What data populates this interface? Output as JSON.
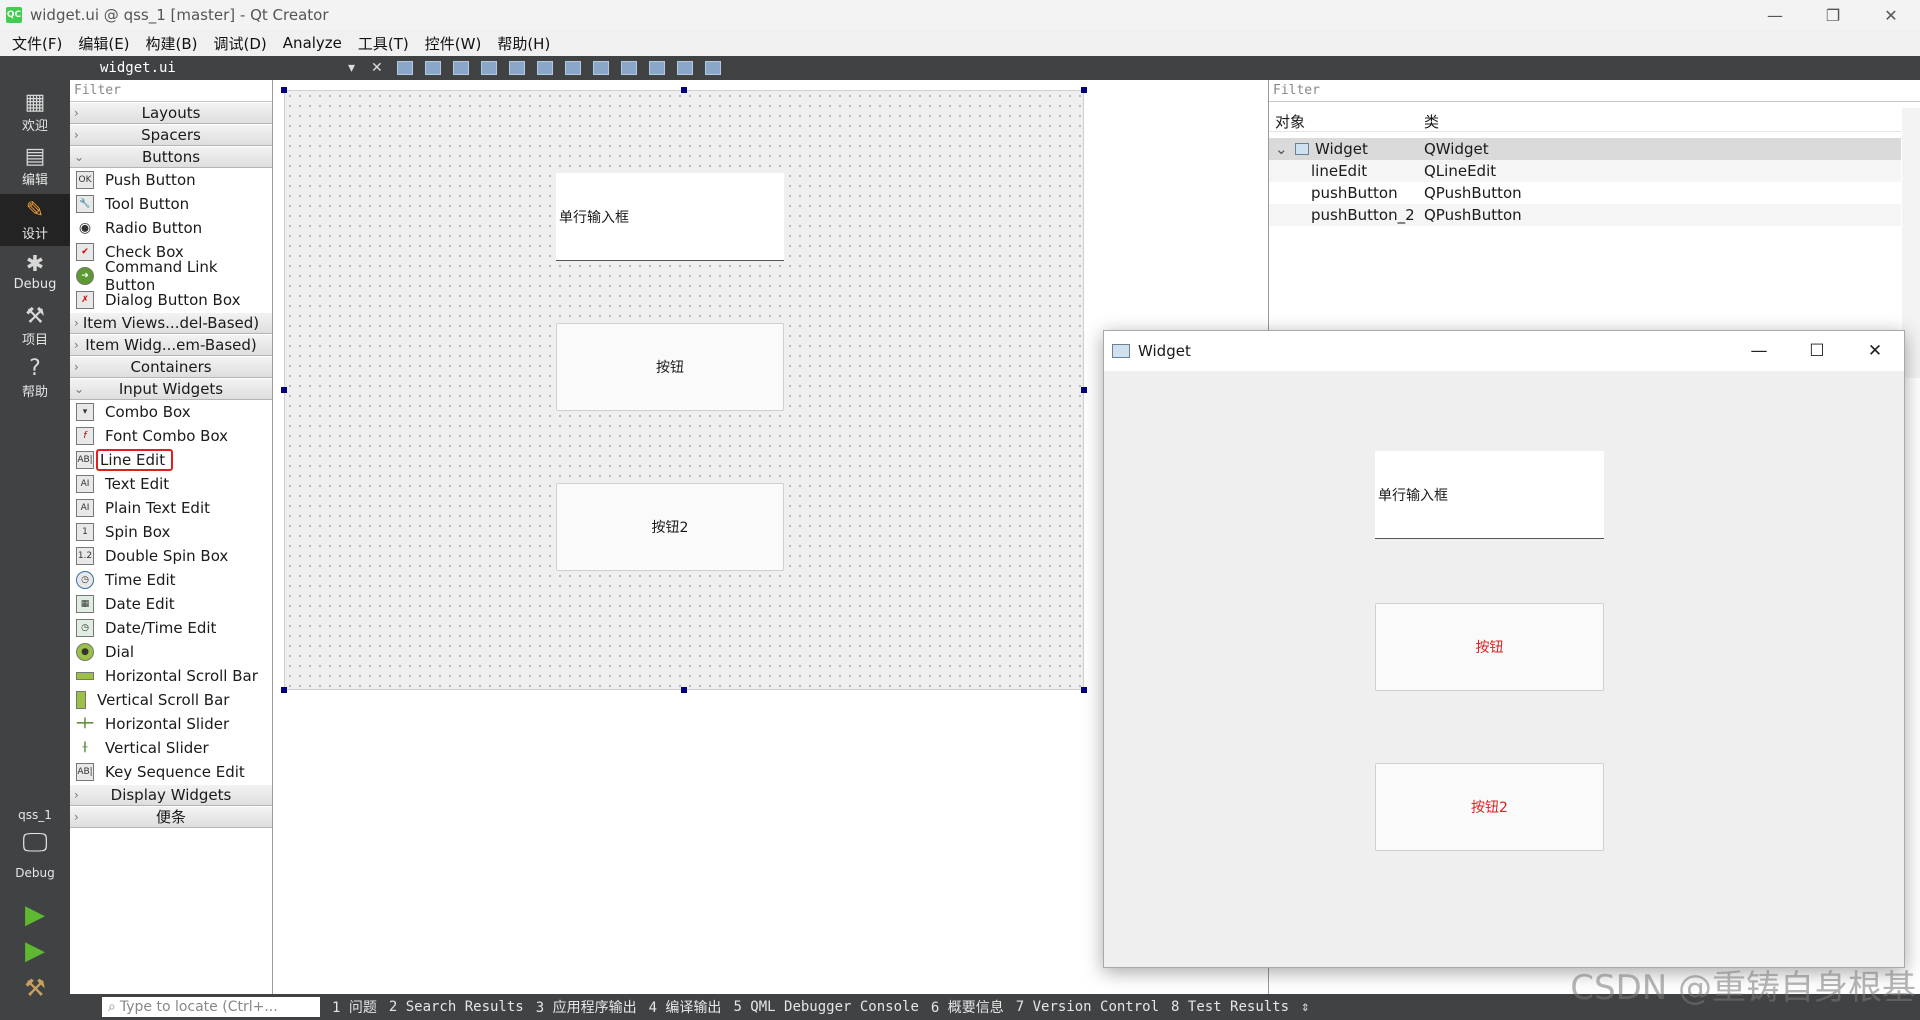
{
  "window": {
    "title": "widget.ui @ qss_1 [master] - Qt Creator",
    "app_icon": "QC"
  },
  "menubar": [
    "文件(F)",
    "编辑(E)",
    "构建(B)",
    "调试(D)",
    "Analyze",
    "工具(T)",
    "控件(W)",
    "帮助(H)"
  ],
  "modes": [
    {
      "label": "欢迎",
      "icon": "grid-icon"
    },
    {
      "label": "编辑",
      "icon": "document-icon"
    },
    {
      "label": "设计",
      "icon": "pencil-icon"
    },
    {
      "label": "Debug",
      "icon": "bug-icon"
    },
    {
      "label": "项目",
      "icon": "wrench-icon"
    },
    {
      "label": "帮助",
      "icon": "help-icon"
    }
  ],
  "kit": {
    "project": "qss_1",
    "target": "Debug"
  },
  "editor_toolbar": {
    "filename": "widget.ui"
  },
  "widgetbox": {
    "filter_placeholder": "Filter",
    "categories": {
      "layouts": "Layouts",
      "spacers": "Spacers",
      "buttons": "Buttons",
      "item_views": "Item Views...del-Based)",
      "item_widgets": "Item Widg...em-Based)",
      "containers": "Containers",
      "input_widgets": "Input Widgets",
      "display_widgets": "Display Widgets",
      "notes": "便条"
    },
    "buttons": [
      "Push Button",
      "Tool Button",
      "Radio Button",
      "Check Box",
      "Command Link Button",
      "Dialog Button Box"
    ],
    "inputs": [
      "Combo Box",
      "Font Combo Box",
      "Line Edit",
      "Text Edit",
      "Plain Text Edit",
      "Spin Box",
      "Double Spin Box",
      "Time Edit",
      "Date Edit",
      "Date/Time Edit",
      "Dial",
      "Horizontal Scroll Bar",
      "Vertical Scroll Bar",
      "Horizontal Slider",
      "Vertical Slider",
      "Key Sequence Edit"
    ]
  },
  "form": {
    "lineedit_text": "单行输入框",
    "button1": "按钮",
    "button2": "按钮2"
  },
  "inspector": {
    "filter_placeholder": "Filter",
    "col_object": "对象",
    "col_class": "类",
    "rows": [
      {
        "object": "Widget",
        "class": "QWidget"
      },
      {
        "object": "lineEdit",
        "class": "QLineEdit"
      },
      {
        "object": "pushButton",
        "class": "QPushButton"
      },
      {
        "object": "pushButton_2",
        "class": "QPushButton"
      }
    ]
  },
  "preview": {
    "title": "Widget",
    "lineedit_text": "单行输入框",
    "button1": "按钮",
    "button2": "按钮2",
    "button_text_color": "#e02020"
  },
  "statusbar": {
    "locate_placeholder": "Type to locate (Ctrl+...",
    "panes": [
      "1 问题",
      "2 Search Results",
      "3 应用程序输出",
      "4 编译输出",
      "5 QML Debugger Console",
      "6 概要信息",
      "7 Version Control",
      "8 Test Results"
    ]
  },
  "watermark": "CSDN @重铸自身根基"
}
